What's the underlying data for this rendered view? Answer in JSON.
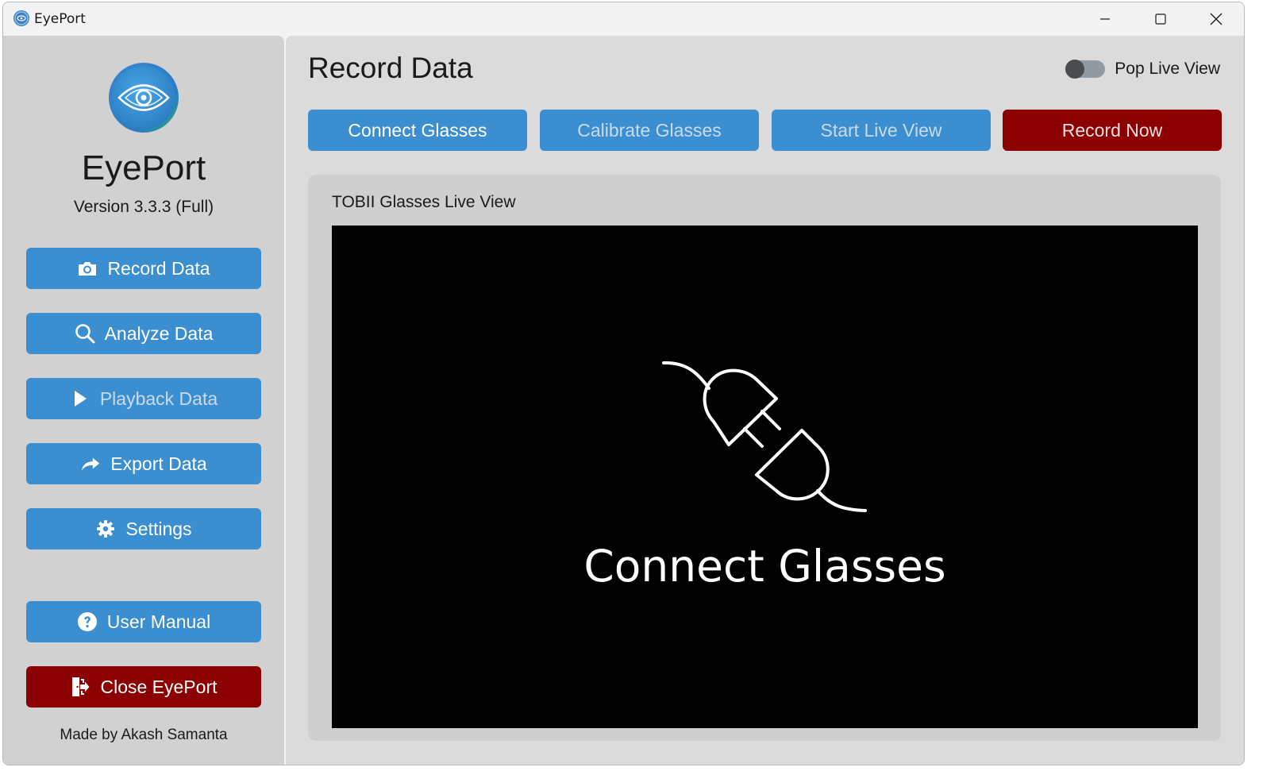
{
  "window": {
    "title": "EyePort",
    "controls": {
      "minimize": "minimize-icon",
      "maximize": "maximize-icon",
      "close": "close-icon"
    }
  },
  "sidebar": {
    "app_name": "EyePort",
    "version": "Version 3.3.3 (Full)",
    "items": [
      {
        "label": "Record Data",
        "icon": "camera-icon"
      },
      {
        "label": "Analyze Data",
        "icon": "search-icon"
      },
      {
        "label": "Playback Data",
        "icon": "play-icon"
      },
      {
        "label": "Export Data",
        "icon": "share-arrow-icon"
      },
      {
        "label": "Settings",
        "icon": "gear-icon"
      }
    ],
    "user_manual": {
      "label": "User Manual",
      "icon": "help-icon"
    },
    "close": {
      "label": "Close EyePort",
      "icon": "exit-icon"
    },
    "credit": "Made by Akash Samanta"
  },
  "main": {
    "title": "Record Data",
    "toggle": {
      "label": "Pop Live View",
      "on": false
    },
    "actions": [
      {
        "label": "Connect Glasses"
      },
      {
        "label": "Calibrate Glasses"
      },
      {
        "label": "Start Live View"
      },
      {
        "label": "Record Now"
      }
    ],
    "live_view": {
      "label": "TOBII Glasses Live View",
      "placeholder": "Connect Glasses",
      "icon": "plug-icon"
    }
  },
  "colors": {
    "accent": "#3b8ed0",
    "danger": "#8b0000",
    "sidebar_bg": "#d1d1d1",
    "main_bg": "#dbdbdb"
  }
}
